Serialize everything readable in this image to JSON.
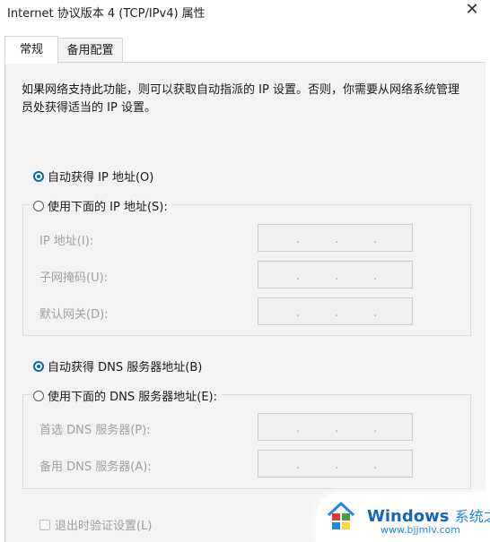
{
  "window": {
    "title": "Internet 协议版本 4 (TCP/IPv4) 属性",
    "close_glyph": "✕"
  },
  "tabs": [
    {
      "label": "常规",
      "active": true
    },
    {
      "label": "备用配置",
      "active": false
    }
  ],
  "description": "如果网络支持此功能，则可以获取自动指派的 IP 设置。否则，你需要从网络系统管理员处获得适当的 IP 设置。",
  "ip": {
    "auto_label": "自动获得 IP 地址(O)",
    "auto_selected": true,
    "manual_label": "使用下面的 IP 地址(S):",
    "fields": [
      {
        "label": "IP 地址(I):"
      },
      {
        "label": "子网掩码(U):"
      },
      {
        "label": "默认网关(D):"
      }
    ]
  },
  "dns": {
    "auto_label": "自动获得 DNS 服务器地址(B)",
    "auto_selected": true,
    "manual_label": "使用下面的 DNS 服务器地址(E):",
    "fields": [
      {
        "label": "首选 DNS 服务器(P):"
      },
      {
        "label": "备用 DNS 服务器(A):"
      }
    ]
  },
  "validate_on_exit": {
    "label": "退出时验证设置(L)",
    "checked": false,
    "enabled": false
  },
  "watermark": {
    "brand": "Windows",
    "brand_cn": "系统之家",
    "url": "www.bjjmlv.com"
  },
  "colors": {
    "accent": "#0067c0",
    "panel_bg": "#f3f3f3",
    "disabled_text": "#a0a0a0"
  }
}
